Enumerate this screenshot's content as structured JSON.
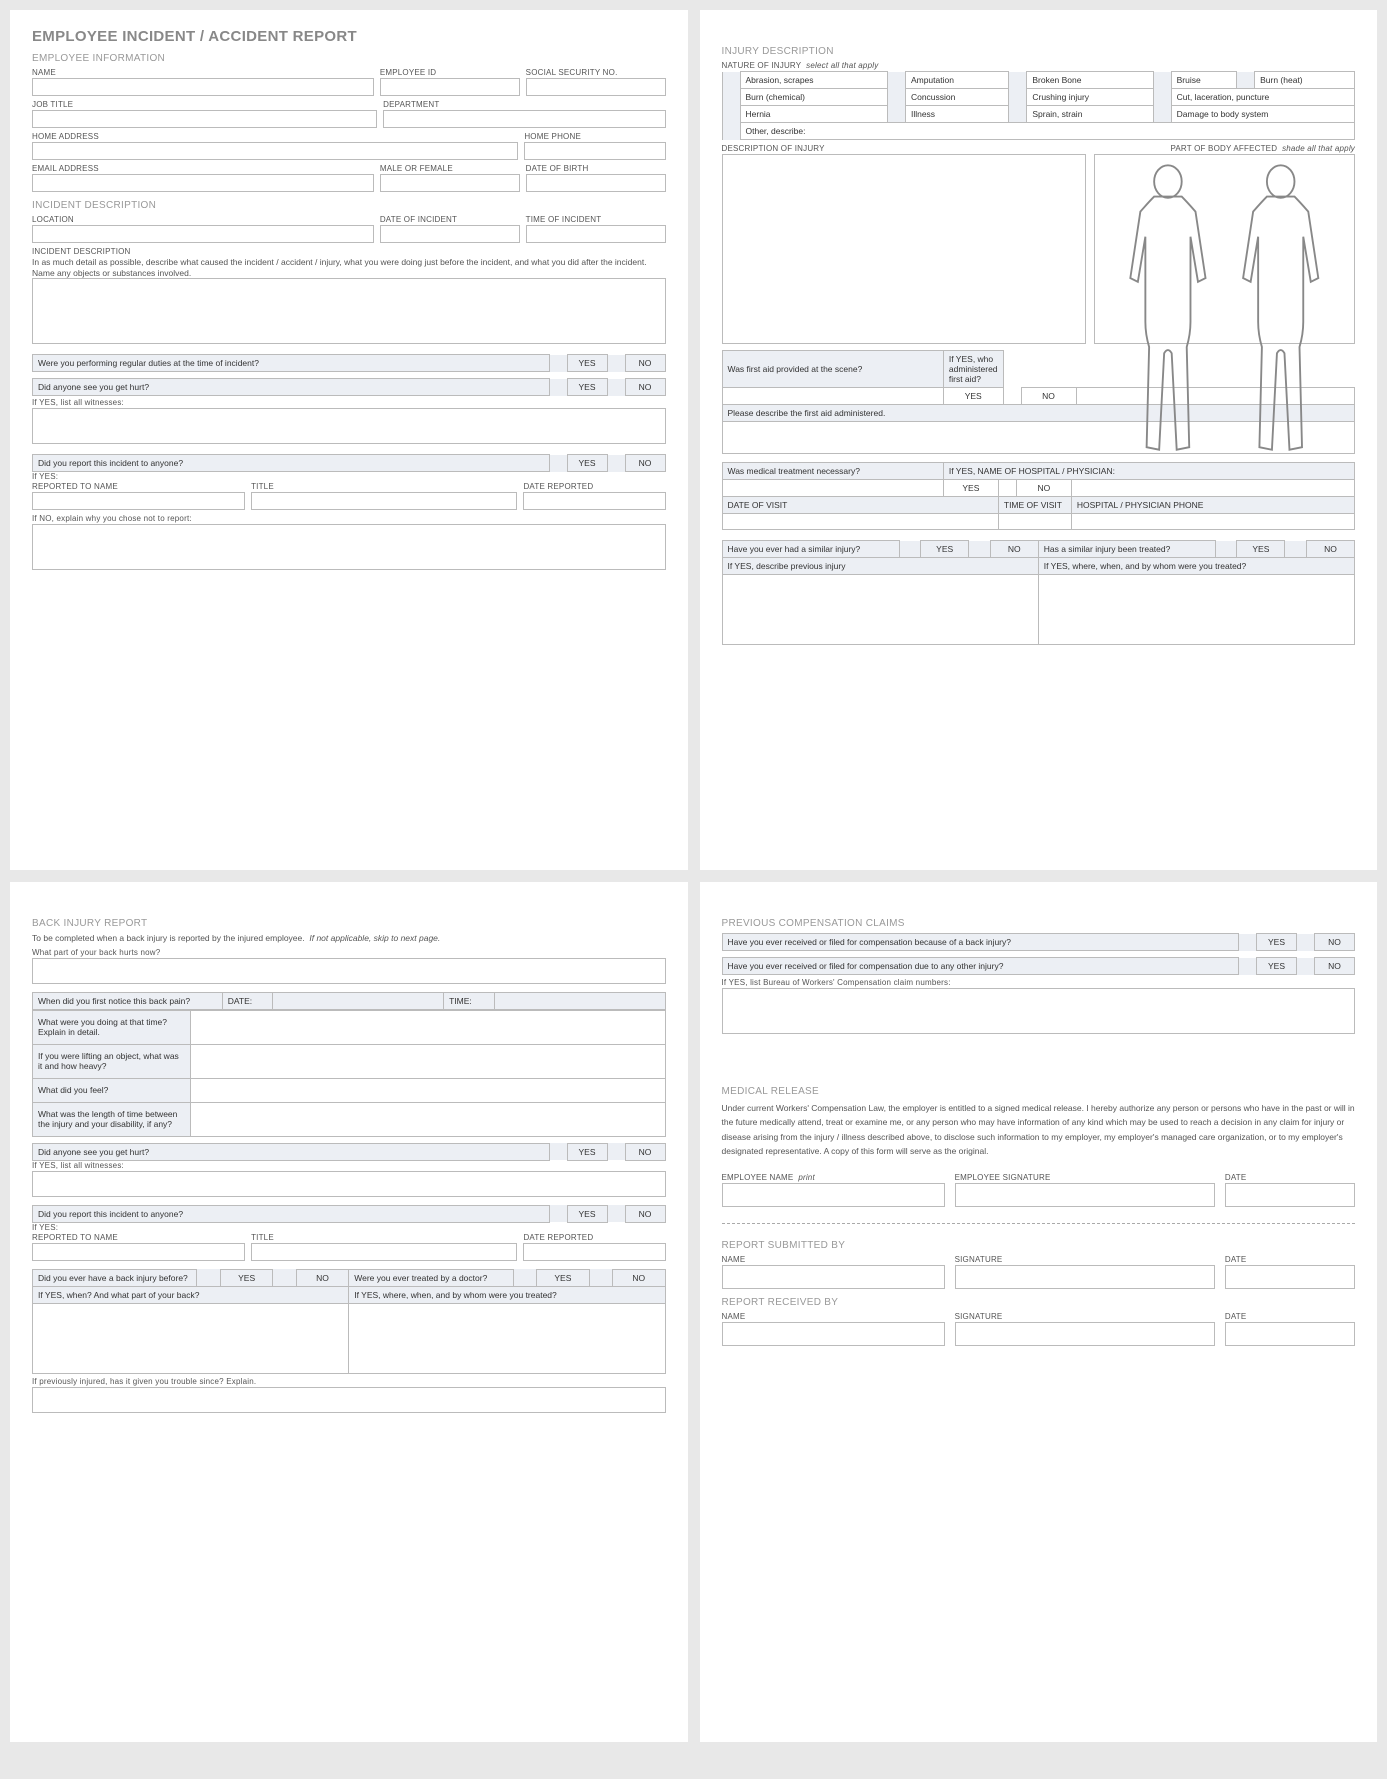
{
  "title": "EMPLOYEE INCIDENT / ACCIDENT REPORT",
  "s": {
    "empInfo": "EMPLOYEE INFORMATION",
    "incDesc": "INCIDENT DESCRIPTION",
    "injDesc": "INJURY DESCRIPTION",
    "back": "BACK INJURY REPORT",
    "prevComp": "PREVIOUS COMPENSATION CLAIMS",
    "medRel": "MEDICAL RELEASE",
    "sub": "REPORT SUBMITTED BY",
    "rec": "REPORT RECEIVED BY"
  },
  "emp": {
    "name": "NAME",
    "empId": "EMPLOYEE ID",
    "ssn": "SOCIAL SECURITY NO.",
    "jobTitle": "JOB TITLE",
    "dept": "DEPARTMENT",
    "homeAddr": "HOME ADDRESS",
    "homePhone": "HOME PHONE",
    "email": "EMAIL ADDRESS",
    "gender": "MALE OR FEMALE",
    "dob": "DATE OF BIRTH"
  },
  "inc": {
    "loc": "LOCATION",
    "date": "DATE OF INCIDENT",
    "time": "TIME OF INCIDENT",
    "descLbl": "INCIDENT DESCRIPTION",
    "descNote": "In as much detail as possible, describe what caused the incident / accident / injury, what you were doing just before the incident, and what you did after the incident.  Name any objects or substances involved.",
    "q1": "Were you performing regular duties at the time of incident?",
    "q2": "Did anyone see you get hurt?",
    "wit": "If YES, list all witnesses:",
    "q3": "Did you report this incident to anyone?",
    "ifYes": "If YES:",
    "repName": "REPORTED TO NAME",
    "repTitle": "TITLE",
    "repDate": "DATE REPORTED",
    "ifNo": "If NO, explain why you chose not to report:"
  },
  "inj": {
    "natLbl": "NATURE OF INJURY",
    "natNote": "select all that apply",
    "n": [
      "Abrasion, scrapes",
      "Amputation",
      "Broken Bone",
      "Bruise",
      "Burn (heat)",
      "Burn (chemical)",
      "Concussion",
      "Crushing injury",
      "Cut, laceration, puncture",
      "Hernia",
      "Illness",
      "Sprain, strain",
      "Damage to body system",
      "Other, describe:"
    ],
    "descLbl": "DESCRIPTION OF INJURY",
    "bodyLbl": "PART OF BODY AFFECTED",
    "bodyNote": "shade all that apply",
    "fa1": "Was first aid provided at the scene?",
    "faWho": "If YES, who administered first aid?",
    "faDesc": "Please describe the first aid administered.",
    "med1": "Was medical treatment necessary?",
    "medWho": "If YES, NAME OF HOSPITAL / PHYSICIAN:",
    "visitDate": "DATE OF VISIT",
    "visitTime": "TIME OF VISIT",
    "hpPhone": "HOSPITAL / PHYSICIAN PHONE",
    "simQ": "Have you ever had a similar injury?",
    "simTreat": "Has a similar injury been treated?",
    "prevInj": "If YES, describe previous injury",
    "prevTreat": "If YES, where, when, and by whom were you treated?"
  },
  "yn": {
    "yes": "YES",
    "no": "NO"
  },
  "back": {
    "note1": "To be completed when a back injury is reported by the injured employee.",
    "note2": "If not applicable, skip to next page.",
    "q1": "What part of your back hurts now?",
    "q2": "When did you first notice this back pain?",
    "date": "DATE:",
    "time": "TIME:",
    "q3": "What were you doing at that time?  Explain in detail.",
    "q4": "If you were lifting an object, what was it and how heavy?",
    "q5": "What did you feel?",
    "q6": "What was the length of time between the injury and your disability, if any?",
    "q7": "Did anyone see you get hurt?",
    "wit": "If YES, list all witnesses:",
    "q8": "Did you report this incident to anyone?",
    "ifYes": "If YES:",
    "repName": "REPORTED TO NAME",
    "repTitle": "TITLE",
    "repDate": "DATE REPORTED",
    "q9": "Did you ever have a back injury before?",
    "q10": "Were you ever treated by a doctor?",
    "q11": "If YES, when? And what part of your back?",
    "q12": "If YES, where, when, and by whom were you treated?",
    "q13": "If previously injured, has it given you trouble since?  Explain."
  },
  "comp": {
    "q1": "Have you ever received or filed for compensation because of a back injury?",
    "q2": "Have you ever received or filed for compensation due to any other injury?",
    "listLbl": "If YES, list Bureau of Workers' Compensation claim numbers:"
  },
  "med": {
    "text": "Under current Workers' Compensation Law, the employer is entitled to a signed medical release.  I hereby authorize any person or persons who have in the past or will in the future medically attend, treat or examine me, or any person who may have information of any kind which may be used to reach a decision in any claim for injury or disease arising from the injury / illness described above, to disclose such information to my employer, my employer's managed care organization, or to my employer's designated representative.  A copy of this form will serve as the original.",
    "ename": "EMPLOYEE NAME",
    "print": "print",
    "esig": "EMPLOYEE SIGNATURE",
    "date": "DATE"
  },
  "sig": {
    "name": "NAME",
    "sig": "SIGNATURE",
    "date": "DATE"
  }
}
